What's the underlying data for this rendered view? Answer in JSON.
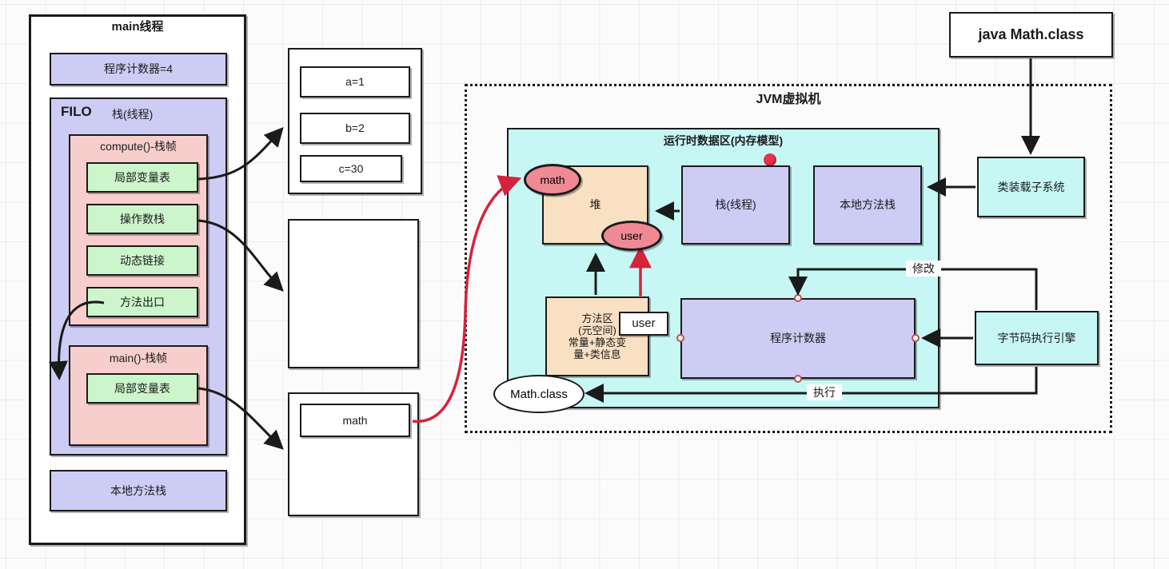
{
  "diagram": {
    "title": "JVM Memory Model Diagram",
    "colors": {
      "purple_fill": "#ccccf5",
      "pink_fill": "#f8cecc",
      "green_fill": "#ccf5cc",
      "cyan_fill": "#c6f7f5",
      "peach_fill": "#fae0c3",
      "ellipse_pink": "#ef8a94",
      "white_fill": "#ffffff",
      "red_accent": "#d6233c",
      "stroke": "#1a1a1a",
      "grid": "#ececed"
    }
  },
  "main_thread": {
    "title": "main线程",
    "program_counter": "程序计数器=4",
    "stack": {
      "filo": "FILO",
      "label": "栈(线程)",
      "compute_frame": {
        "title": "compute()-栈帧",
        "items": [
          "局部变量表",
          "操作数栈",
          "动态链接",
          "方法出口"
        ]
      },
      "main_frame": {
        "title": "main()-栈帧",
        "items": [
          "局部变量表"
        ]
      }
    },
    "native_method_stack": "本地方法栈"
  },
  "locals_panel": {
    "variables": [
      "a=1",
      "b=2",
      "c=30"
    ]
  },
  "empty_panel": {
    "content": ""
  },
  "object_panel": {
    "items": [
      "math"
    ]
  },
  "jvm": {
    "title": "JVM虚拟机",
    "runtime_area": {
      "title": "运行时数据区(内存模型)",
      "heap": {
        "label": "堆",
        "objects": [
          "math",
          "user"
        ]
      },
      "stack": "栈(线程)",
      "native_method_stack": "本地方法栈",
      "method_area": {
        "lines": [
          "方法区",
          "(元空间)",
          "常量+静态变",
          "量+类信息"
        ],
        "tag": "user"
      },
      "program_counter": "程序计数器",
      "class_ellipse": "Math.class"
    },
    "edges": {
      "modify": "修改",
      "execute": "执行"
    }
  },
  "right_column": {
    "entry_command": "java Math.class",
    "class_loader": "类装载子系统",
    "execution_engine": "字节码执行引擎"
  }
}
